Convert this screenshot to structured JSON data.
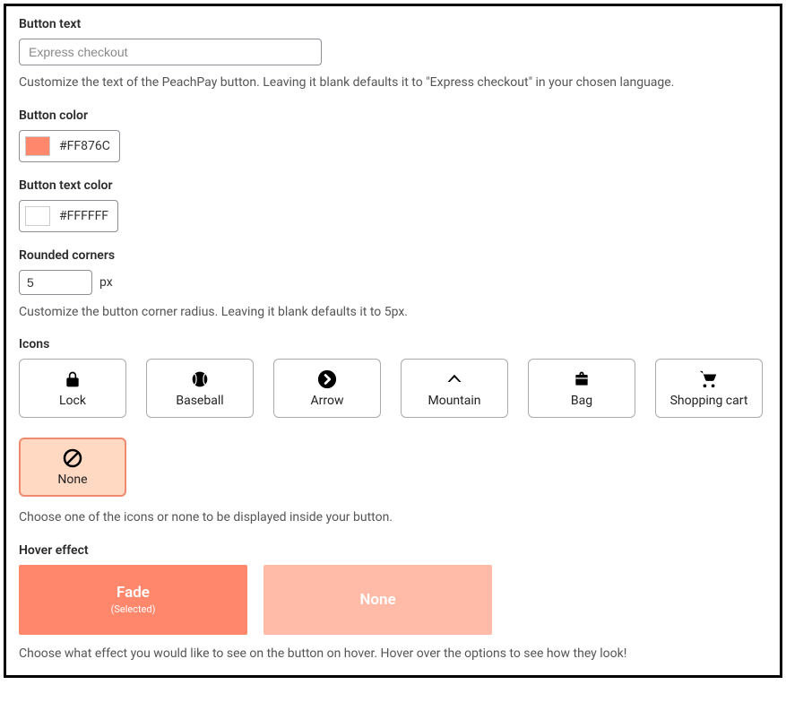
{
  "buttonText": {
    "label": "Button text",
    "placeholder": "Express checkout",
    "value": "",
    "help": "Customize the text of the PeachPay button. Leaving it blank defaults it to \"Express checkout\" in your chosen language."
  },
  "buttonColor": {
    "label": "Button color",
    "value": "#FF876C",
    "swatch": "#FF876C"
  },
  "buttonTextColor": {
    "label": "Button text color",
    "value": "#FFFFFF",
    "swatch": "#FFFFFF"
  },
  "roundedCorners": {
    "label": "Rounded corners",
    "value": "5",
    "unit": "px",
    "help": "Customize the button corner radius. Leaving it blank defaults it to 5px."
  },
  "icons": {
    "label": "Icons",
    "options": [
      {
        "name": "Lock"
      },
      {
        "name": "Baseball"
      },
      {
        "name": "Arrow"
      },
      {
        "name": "Mountain"
      },
      {
        "name": "Bag"
      },
      {
        "name": "Shopping cart"
      },
      {
        "name": "None"
      }
    ],
    "help": "Choose one of the icons or none to be displayed inside your button."
  },
  "hoverEffect": {
    "label": "Hover effect",
    "options": [
      {
        "name": "Fade",
        "selected": "(Selected)"
      },
      {
        "name": "None"
      }
    ],
    "help": "Choose what effect you would like to see on the button on hover. Hover over the options to see how they look!"
  }
}
